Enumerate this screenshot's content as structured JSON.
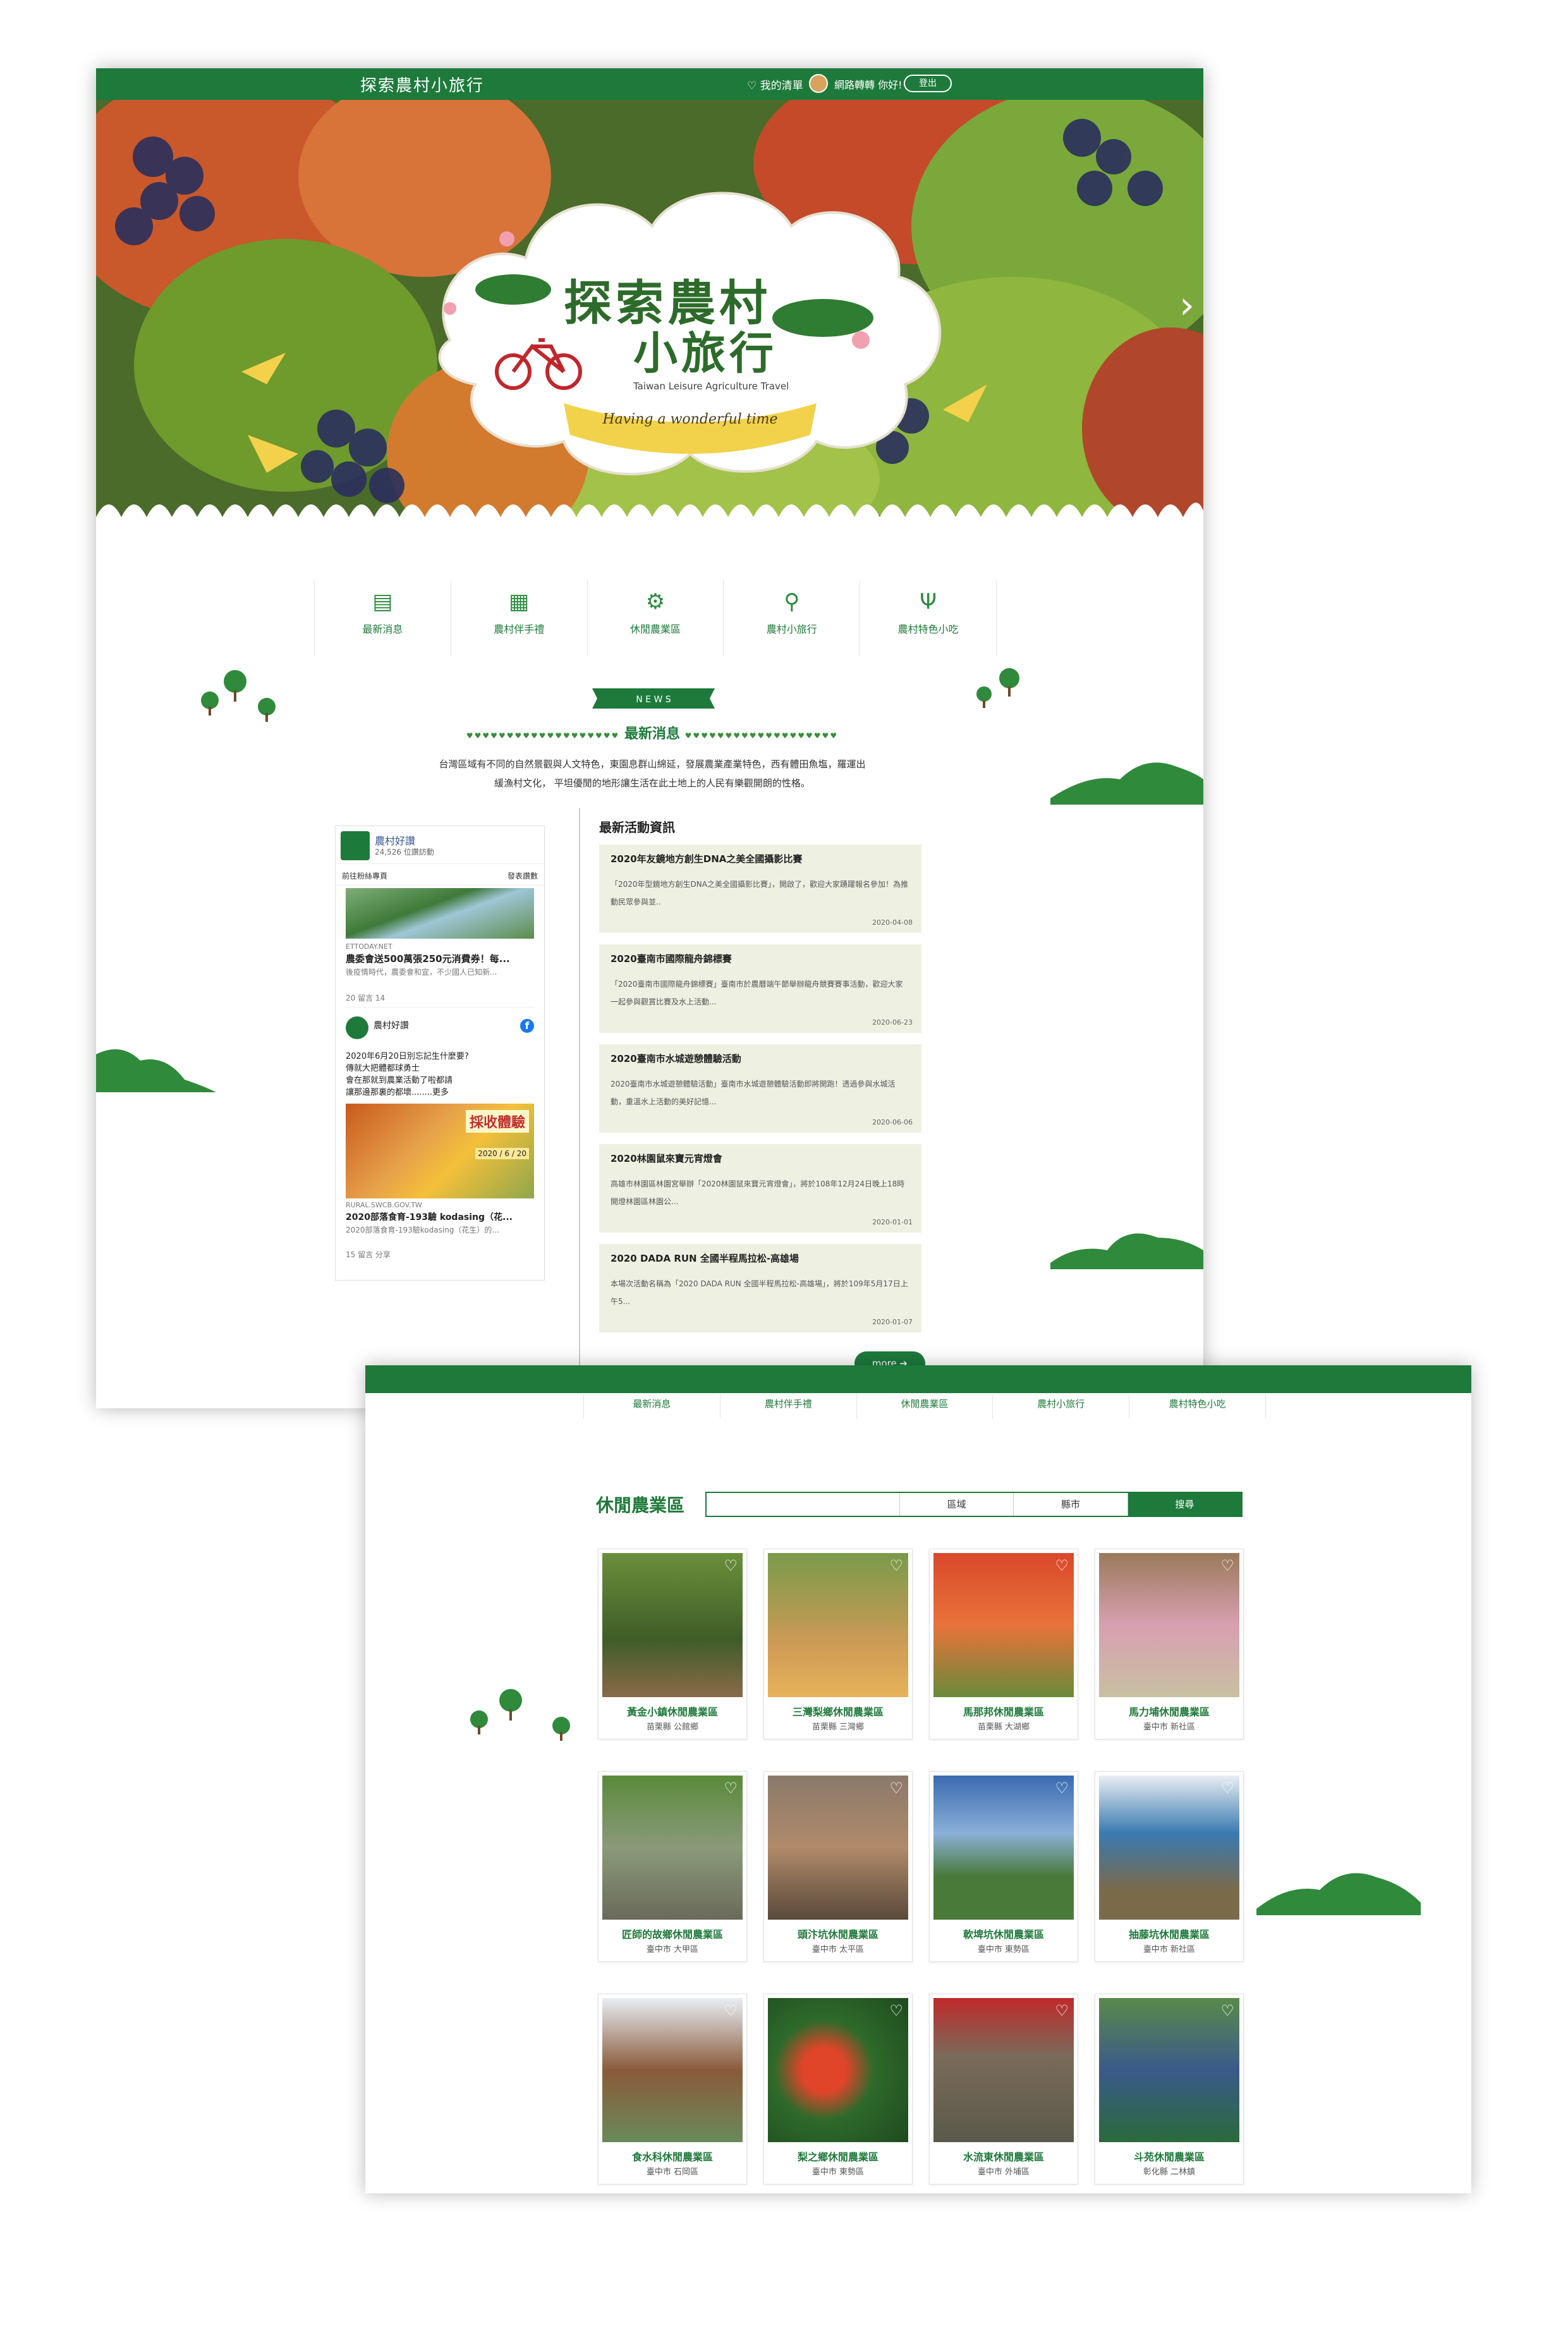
{
  "header": {
    "logo": "探索農村小旅行",
    "wishlist_label": "我的清單",
    "greeting": "網路轉轉 你好!",
    "logout_label": "登出"
  },
  "hero": {
    "title_line1": "探索農村",
    "title_line2": "小旅行",
    "subtitle_en": "Taiwan Leisure Agriculture Travel",
    "ribbon": "Having a wonderful time"
  },
  "categories": [
    {
      "icon": "newspaper-icon",
      "label": "最新消息"
    },
    {
      "icon": "gift-icon",
      "label": "農村伴手禮"
    },
    {
      "icon": "tractor-icon",
      "label": "休閒農業區"
    },
    {
      "icon": "bicycle-icon",
      "label": "農村小旅行"
    },
    {
      "icon": "fork-knife-icon",
      "label": "農村特色小吃"
    }
  ],
  "news": {
    "badge": "N E W S",
    "title": "最新消息",
    "description": "台灣區域有不同的自然景觀與人文特色，東園息群山綿延，發展農業產業特色，西有體田魚塩，羅運出   \n緩漁村文化， 平坦優閒的地形讓生活在此土地上的人民有樂觀開朗的性格。"
  },
  "facebook": {
    "page_name": "農村好讚",
    "followers": "24,526 位讚訪動",
    "share_label": "分享",
    "visit_label": "前往粉絲專頁",
    "like_label": "發表讚數",
    "post1": {
      "source": "ETTODAY.NET",
      "title": "農委會送500萬張250元消費券！每...",
      "subtitle": "後疫情時代，農委會和宜，不少國人已知新...",
      "reactions": "20   留言   14"
    },
    "post2": {
      "page": "農村好讚",
      "text": "2020年6月20日別忘記生什麼要?\n傳就大把體都球勇士\n會在那就到農業活動了啦都請\n讓那邊那裏的都壞........更多",
      "tag": "採收體驗",
      "date": "2020 / 6 / 20",
      "source": "RURAL.SWCB.GOV.TW",
      "title": "2020部落食育-193驗 kodasing（花...",
      "subtitle": "2020部落食育-193驗kodasing（花生）的...",
      "reactions": "15   留言   分享"
    }
  },
  "news_list": {
    "heading": "最新活動資訊",
    "items": [
      {
        "title": "2020年友鏡地方創生DNA之美全國攝影比賽",
        "desc": "「2020年型鏡地方創生DNA之美全國攝影比賽」，開啟了，歡迎大家踴躍報名參加！為推動民眾參與並..",
        "date": "2020-04-08"
      },
      {
        "title": "2020臺南市國際龍舟錦標賽",
        "desc": "「2020臺南市國際龍舟錦標賽」臺南市於農曆端午節舉辦龍舟競賽賽事活動，歡迎大家一起參與觀賞比賽及水上活動...",
        "date": "2020-06-23"
      },
      {
        "title": "2020臺南市水城遊憩體驗活動",
        "desc": "2020臺南市水城遊憩體驗活動」臺南市水城遊憩體驗活動即將開跑！透過參與水城活動，重溫水上活動的美好記憶...",
        "date": "2020-06-06"
      },
      {
        "title": "2020林園鼠來寶元宵燈會",
        "desc": "高雄市林園區林園宮舉辦「2020林園鼠來寶元宵燈會」，將於108年12月24日晚上18時開燈林園區林園公...",
        "date": "2020-01-01"
      },
      {
        "title": "2020 DADA RUN 全國半程馬拉松-高雄場",
        "desc": "本場次活動名稱為「2020 DADA RUN 全國半程馬拉松-高雄場」，將於109年5月17日上午5...",
        "date": "2020-01-07"
      }
    ],
    "more_label": "more"
  },
  "page2": {
    "nav": [
      "最新消息",
      "農村伴手禮",
      "休閒農業區",
      "農村小旅行",
      "農村特色小吃"
    ],
    "title": "休閒農業區",
    "filters": [
      "區域",
      "縣市",
      "搜尋"
    ],
    "farms": [
      {
        "name": "黃金小鎮休閒農業區",
        "loc": "苗栗縣 公館鄉"
      },
      {
        "name": "三灣梨鄉休閒農業區",
        "loc": "苗栗縣 三灣鄉"
      },
      {
        "name": "馬那邦休閒農業區",
        "loc": "苗栗縣 大湖鄉"
      },
      {
        "name": "馬力埔休閒農業區",
        "loc": "臺中市 新社區"
      },
      {
        "name": "匠師的故鄉休閒農業區",
        "loc": "臺中市 大甲區"
      },
      {
        "name": "頭汴坑休閒農業區",
        "loc": "臺中市 太平區"
      },
      {
        "name": "軟埤坑休閒農業區",
        "loc": "臺中市 東勢區"
      },
      {
        "name": "抽藤坑休閒農業區",
        "loc": "臺中市 新社區"
      },
      {
        "name": "食水科休閒農業區",
        "loc": "臺中市 石岡區"
      },
      {
        "name": "梨之鄉休閒農業區",
        "loc": "臺中市 東勢區"
      },
      {
        "name": "水流東休閒農業區",
        "loc": "臺中市 外埔區"
      },
      {
        "name": "斗苑休閒農業區",
        "loc": "彰化縣 二林鎮"
      }
    ]
  },
  "colors": {
    "brand_green": "#1d7a3b",
    "news_bg": "#eef1e2"
  }
}
